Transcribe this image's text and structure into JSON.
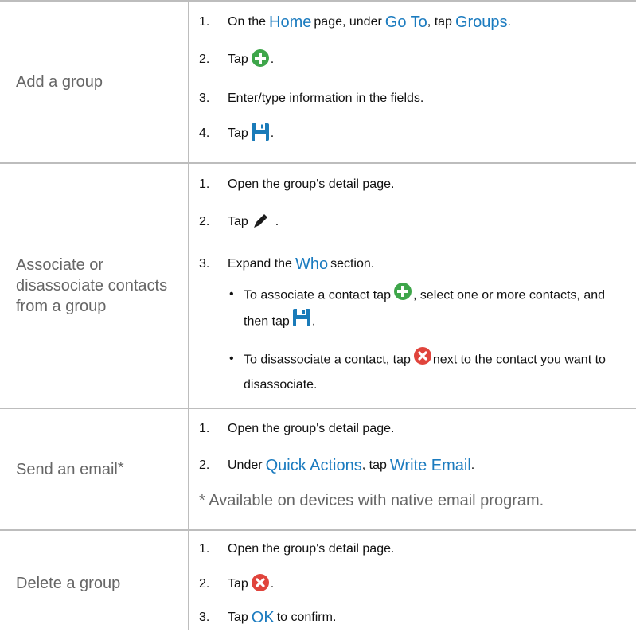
{
  "rows": [
    {
      "task": "Add a group",
      "steps": [
        {
          "num": "1.",
          "a": "On the",
          "home": "Home",
          "b": "page, under",
          "goto": "Go To",
          "c": ", tap",
          "groups": "Groups",
          "d": "."
        },
        {
          "num": "2.",
          "a": "Tap",
          "icon": "add-icon",
          "b": "."
        },
        {
          "num": "3.",
          "a": "Enter/type information in the fields."
        },
        {
          "num": "4.",
          "a": "Tap",
          "icon": "save-icon",
          "b": "."
        }
      ]
    },
    {
      "task": "Associate or disassociate contacts from a group",
      "steps": [
        {
          "num": "1.",
          "a": "Open the group's detail page."
        },
        {
          "num": "2.",
          "a": "Tap",
          "icon": "edit-icon",
          "b": "."
        },
        {
          "num": "3.",
          "a": "Expand the",
          "who": "Who",
          "b": "section."
        }
      ],
      "bullets": [
        {
          "dot": "•",
          "a": "To associate a contact tap",
          "b": ", select one or more contacts, and then tap",
          "c": "."
        },
        {
          "dot": "•",
          "a": "To disassociate a contact, tap",
          "b": "next to the contact you want to disassociate."
        }
      ]
    },
    {
      "task": "Send an email",
      "task_mark": "*",
      "steps": [
        {
          "num": "1.",
          "a": "Open the group's detail page."
        },
        {
          "num": "2.",
          "a": "Under",
          "qa": "Quick Actions",
          "b": ", tap",
          "we": "Write Email",
          "c": "."
        }
      ],
      "note": "* Available on devices with native email program."
    },
    {
      "task": "Delete a group",
      "steps": [
        {
          "num": "1.",
          "a": "Open the group's detail page."
        },
        {
          "num": "2.",
          "a": "Tap",
          "icon": "delete-icon",
          "b": "."
        },
        {
          "num": "3.",
          "a": "Tap",
          "ok": "OK",
          "b": "to confirm."
        }
      ]
    }
  ],
  "colors": {
    "link": "#1b7bbf",
    "add": "#3ea64a",
    "save": "#1a7bb9",
    "delete": "#e0443c",
    "rule": "#bdbdbd",
    "task_text": "#666666"
  }
}
